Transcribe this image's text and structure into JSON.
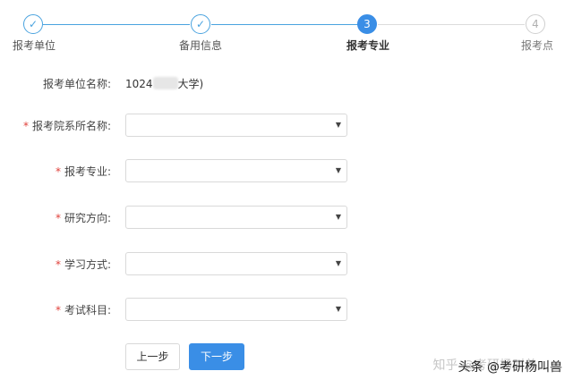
{
  "steps": [
    {
      "label": "报考单位",
      "state": "done",
      "icon": "check-icon",
      "glyph": "✓"
    },
    {
      "label": "备用信息",
      "state": "done",
      "icon": "check-icon",
      "glyph": "✓"
    },
    {
      "label": "报考专业",
      "state": "active",
      "number": "3"
    },
    {
      "label": "报考点",
      "state": "todo",
      "number": "4"
    }
  ],
  "form": {
    "unit_label": "报考单位名称:",
    "unit_value_prefix": "1024",
    "unit_value_suffix": "大学)",
    "required_mark": "*",
    "fields": [
      {
        "label": "报考院系所名称:"
      },
      {
        "label": "报考专业:"
      },
      {
        "label": "研究方向:"
      },
      {
        "label": "学习方式:"
      },
      {
        "label": "考试科目:"
      }
    ],
    "caret": "▼"
  },
  "buttons": {
    "prev": "上一步",
    "next": "下一步"
  },
  "watermark": {
    "faint": "知乎 @考研杨叫兽",
    "main": "头条 @考研杨叫兽"
  },
  "colors": {
    "accent": "#3a8ee6",
    "done": "#4aa3df",
    "required": "#e0403a"
  }
}
